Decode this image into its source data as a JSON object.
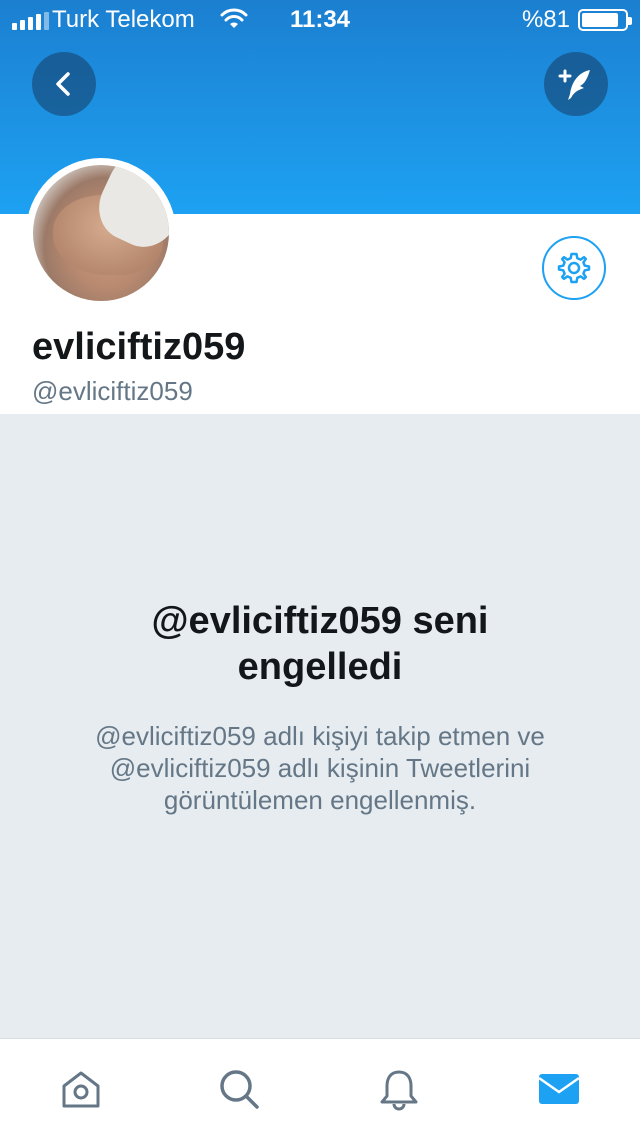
{
  "status_bar": {
    "carrier": "Turk Telekom",
    "time": "11:34",
    "battery": "%81"
  },
  "profile": {
    "display_name": "evliciftiz059",
    "handle": "@evliciftiz059"
  },
  "blocked": {
    "title": "@evliciftiz059 seni engelledi",
    "description": "@evliciftiz059 adlı kişiyi takip etmen ve @evliciftiz059 adlı kişinin Tweetlerini görüntülemen engellenmiş."
  },
  "tabs": [
    {
      "icon": "home-icon",
      "active": false
    },
    {
      "icon": "search-icon",
      "active": false
    },
    {
      "icon": "bell-icon",
      "active": false
    },
    {
      "icon": "mail-icon",
      "active": true
    }
  ],
  "colors": {
    "accent": "#1da1f2",
    "header_dark": "#1c7fd0",
    "muted_text": "#657786",
    "background_gray": "#e6ecf0",
    "tab_inactive": "#657786"
  }
}
